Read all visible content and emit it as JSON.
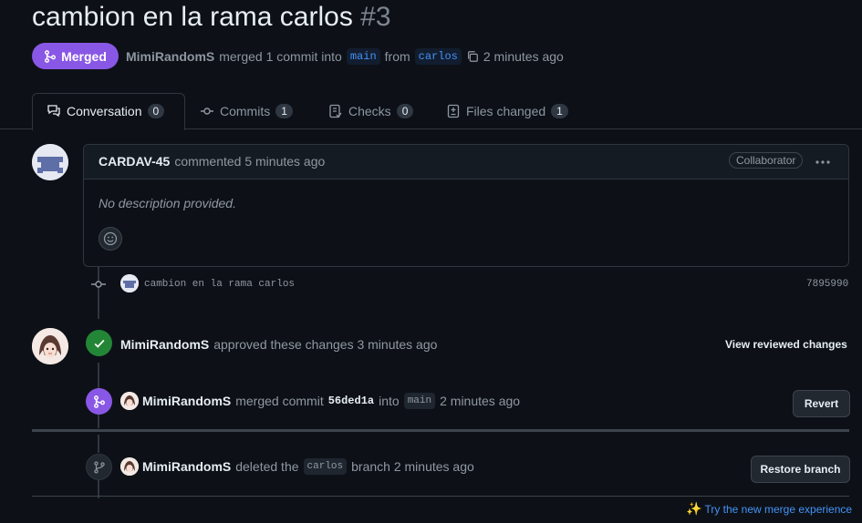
{
  "pr": {
    "title": "cambion en la rama carlos",
    "number": "#3",
    "status": "Merged",
    "author": "MimiRandomS",
    "merge_text": "merged 1 commit into",
    "base_branch": "main",
    "from_text": "from",
    "head_branch": "carlos",
    "time": "2 minutes ago"
  },
  "tabs": [
    {
      "label": "Conversation",
      "count": "0",
      "icon": "conversation-icon"
    },
    {
      "label": "Commits",
      "count": "1",
      "icon": "commit-icon"
    },
    {
      "label": "Checks",
      "count": "0",
      "icon": "checklist-icon"
    },
    {
      "label": "Files changed",
      "count": "1",
      "icon": "file-diff-icon"
    }
  ],
  "comment": {
    "author": "CARDAV-45",
    "action": "commented 5 minutes ago",
    "role": "Collaborator",
    "body": "No description provided."
  },
  "commit": {
    "message": "cambion en la rama carlos",
    "sha": "7895990"
  },
  "review": {
    "author": "MimiRandomS",
    "text": "approved these changes 3 minutes ago",
    "button": "View reviewed changes"
  },
  "merge_event": {
    "author": "MimiRandomS",
    "text1": "merged commit",
    "sha": "56ded1a",
    "text2": "into",
    "branch": "main",
    "time": "2 minutes ago",
    "button": "Revert"
  },
  "delete_event": {
    "author": "MimiRandomS",
    "text1": "deleted the",
    "branch": "carlos",
    "text2": "branch 2 minutes ago",
    "button": "Restore branch"
  },
  "footer": {
    "link": "Try the new merge experience"
  },
  "colors": {
    "merged": "#8957e5",
    "approved": "#238636",
    "link": "#4493f8"
  }
}
